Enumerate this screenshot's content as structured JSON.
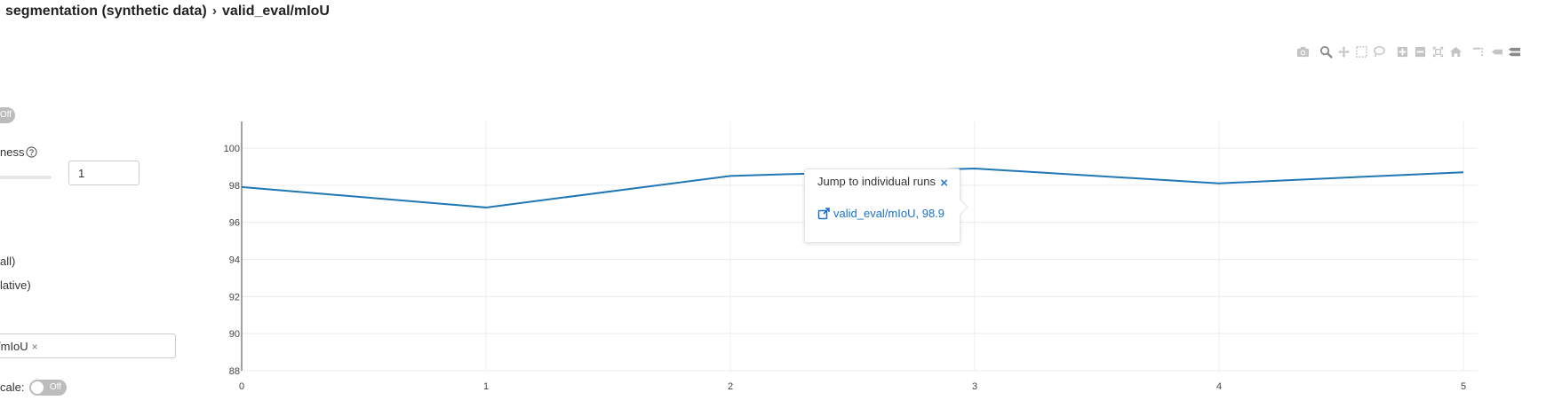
{
  "breadcrumb": {
    "parent": "segmentation (synthetic data)",
    "separator": "›",
    "current": "valid_eval/mIoU"
  },
  "toolbar": {
    "icons": [
      "camera-icon",
      "zoom-icon",
      "pan-icon",
      "box-select-icon",
      "lasso-select-icon",
      "zoom-in-icon",
      "zoom-out-icon",
      "autoscale-icon",
      "home-icon",
      "spike-lines-icon",
      "hover-closest-icon",
      "hover-compare-icon"
    ]
  },
  "sidebar": {
    "top_toggle": "Off",
    "smoothness_label": "ness",
    "smoothness_value": "1",
    "x_axis_option_1": "all)",
    "x_axis_option_2": "lative)",
    "metric_tag": "/mIoU",
    "tag_remove": "×",
    "log_scale_label": "cale:",
    "log_scale_toggle": "Off"
  },
  "tooltip": {
    "title": "Jump to individual runs",
    "close": "×",
    "link": "valid_eval/mIoU, 98.9"
  },
  "colors": {
    "series": "#1f77b4",
    "link": "#1a73c8",
    "toggle": "#bcbcbc",
    "grid": "#ececec"
  },
  "chart_data": {
    "type": "line",
    "x": [
      0,
      1,
      2,
      3,
      4,
      5
    ],
    "series": [
      {
        "values": [
          97.9,
          96.8,
          98.5,
          98.9,
          98.1,
          98.7
        ]
      }
    ],
    "xticks": [
      "0",
      "1",
      "2",
      "3",
      "4",
      "5"
    ],
    "yticks": [
      "88",
      "90",
      "92",
      "94",
      "96",
      "98",
      "100"
    ],
    "xlim": [
      0,
      5
    ],
    "ylim": [
      88,
      100
    ],
    "grid": true
  }
}
